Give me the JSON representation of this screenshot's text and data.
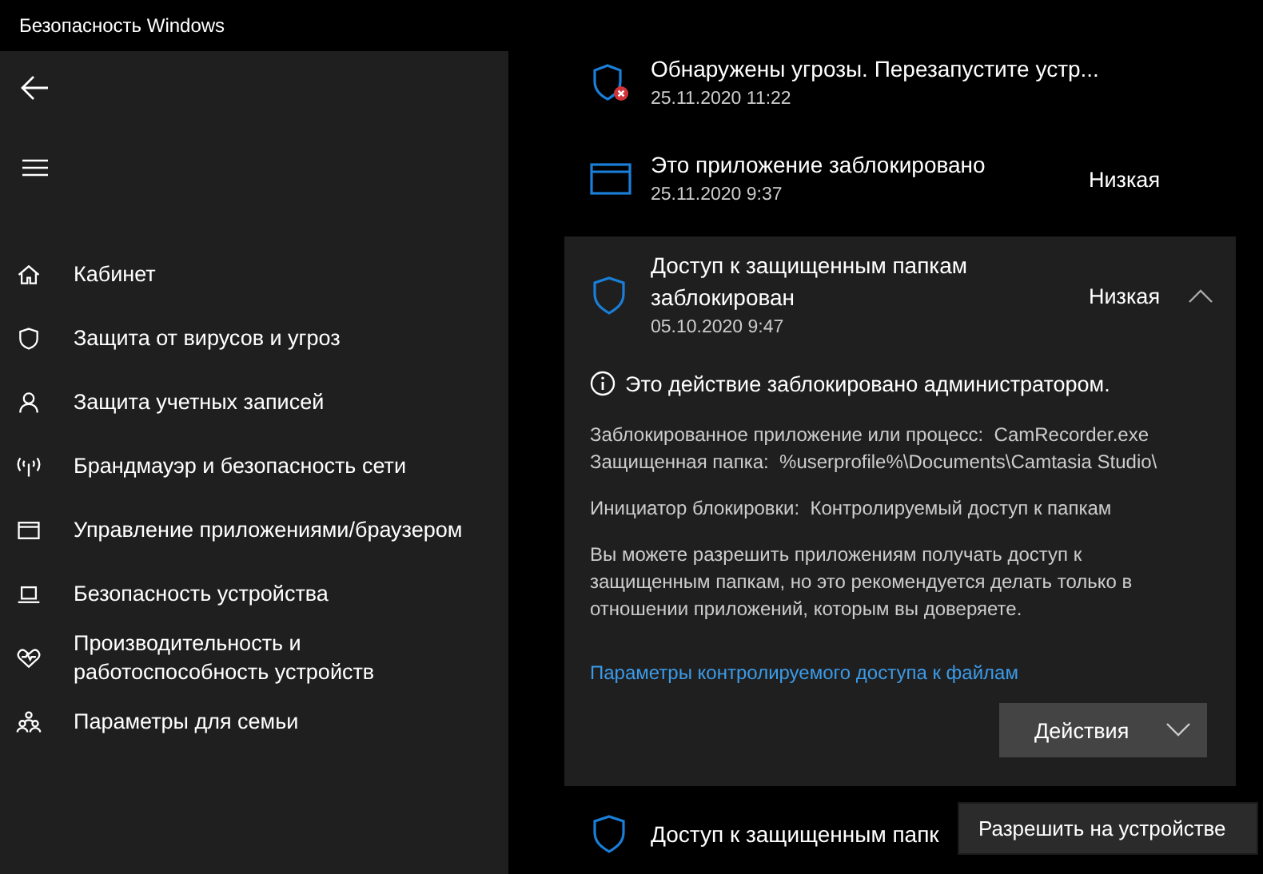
{
  "window": {
    "title": "Безопасность Windows"
  },
  "sidebar": {
    "items": [
      {
        "kind": "home",
        "label": "Кабинет",
        "selected": false
      },
      {
        "kind": "shield",
        "label": "Защита от вирусов и угроз",
        "selected": false
      },
      {
        "kind": "person",
        "label": "Защита учетных записей",
        "selected": false
      },
      {
        "kind": "antenna",
        "label": "Брандмауэр и безопасность сети",
        "selected": false
      },
      {
        "kind": "window",
        "label": "Управление приложениями/браузером",
        "selected": false
      },
      {
        "kind": "laptop",
        "label": "Безопасность устройства",
        "selected": false
      },
      {
        "kind": "heart",
        "label": "Производительность и работоспособность устройств",
        "selected": false
      },
      {
        "kind": "family",
        "label": "Параметры для семьи",
        "selected": false
      }
    ]
  },
  "history": [
    {
      "kind": "threat",
      "title": "Обнаружены угрозы. Перезапустите устр...",
      "date": "25.11.2020 11:22",
      "expanded": false
    },
    {
      "kind": "app_block",
      "title": "Это приложение заблокировано",
      "date": "25.11.2020 9:37",
      "severity": "Низкая",
      "expanded": false
    },
    {
      "kind": "folder_block",
      "title": "Доступ к защищенным папкам заблокирован",
      "date": "05.10.2020 9:47",
      "severity": "Низкая",
      "expanded": true,
      "details": {
        "notice": "Это действие заблокировано администратором.",
        "lines": [
          "Заблокированное приложение или процесс:  CamRecorder.exe",
          "Защищенная папка:  %userprofile%\\Documents\\Camtasia Studio\\"
        ],
        "initiator": "Инициатор блокировки:  Контролируемый доступ к папкам",
        "paragraph": "Вы можете разрешить приложениям получать доступ к защищенным папкам, но это рекомендуется делать только в отношении приложений, которым вы доверяете.",
        "link": "Параметры контролируемого доступа к файлам",
        "actions_button": "Действия",
        "actions_menu": [
          "Разрешить на устройстве"
        ]
      }
    },
    {
      "kind": "folder_block",
      "title": "Доступ к защищенным папк",
      "expanded": false
    }
  ]
}
